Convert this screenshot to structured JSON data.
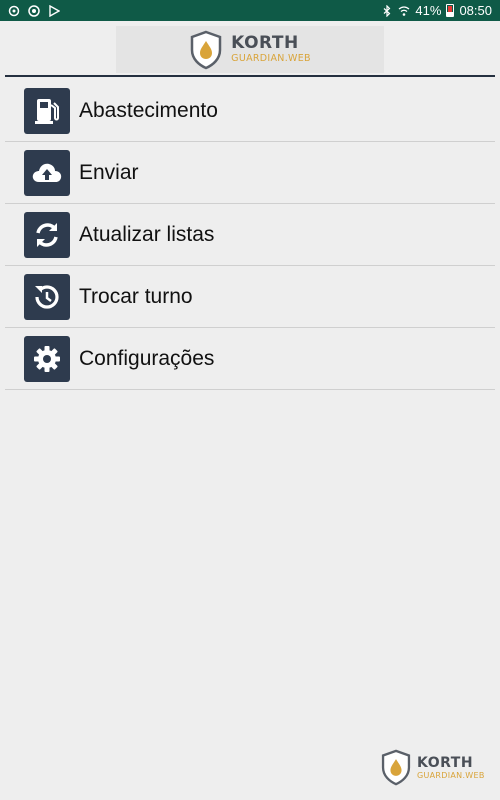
{
  "status_bar": {
    "battery_percent": "41%",
    "time": "08:50",
    "left_icons": [
      "sync-icon",
      "chrome-icon",
      "play-store-icon"
    ],
    "right_icons": [
      "bluetooth-icon",
      "wifi-icon",
      "battery-icon"
    ]
  },
  "brand": {
    "name": "KORTH",
    "subtitle": "GUARDIAN.WEB",
    "colors": {
      "shield": "#5a6069",
      "drop": "#d9a43a",
      "name": "#4a4f57"
    }
  },
  "menu": {
    "items": [
      {
        "label": "Abastecimento",
        "icon": "fuel-pump-icon"
      },
      {
        "label": "Enviar",
        "icon": "cloud-upload-icon"
      },
      {
        "label": "Atualizar listas",
        "icon": "refresh-icon"
      },
      {
        "label": "Trocar turno",
        "icon": "clock-history-icon"
      },
      {
        "label": "Configurações",
        "icon": "gear-icon"
      }
    ]
  },
  "colors": {
    "status_bar": "#0f5a47",
    "tile": "#2e3b4e",
    "background": "#eeeeee"
  }
}
